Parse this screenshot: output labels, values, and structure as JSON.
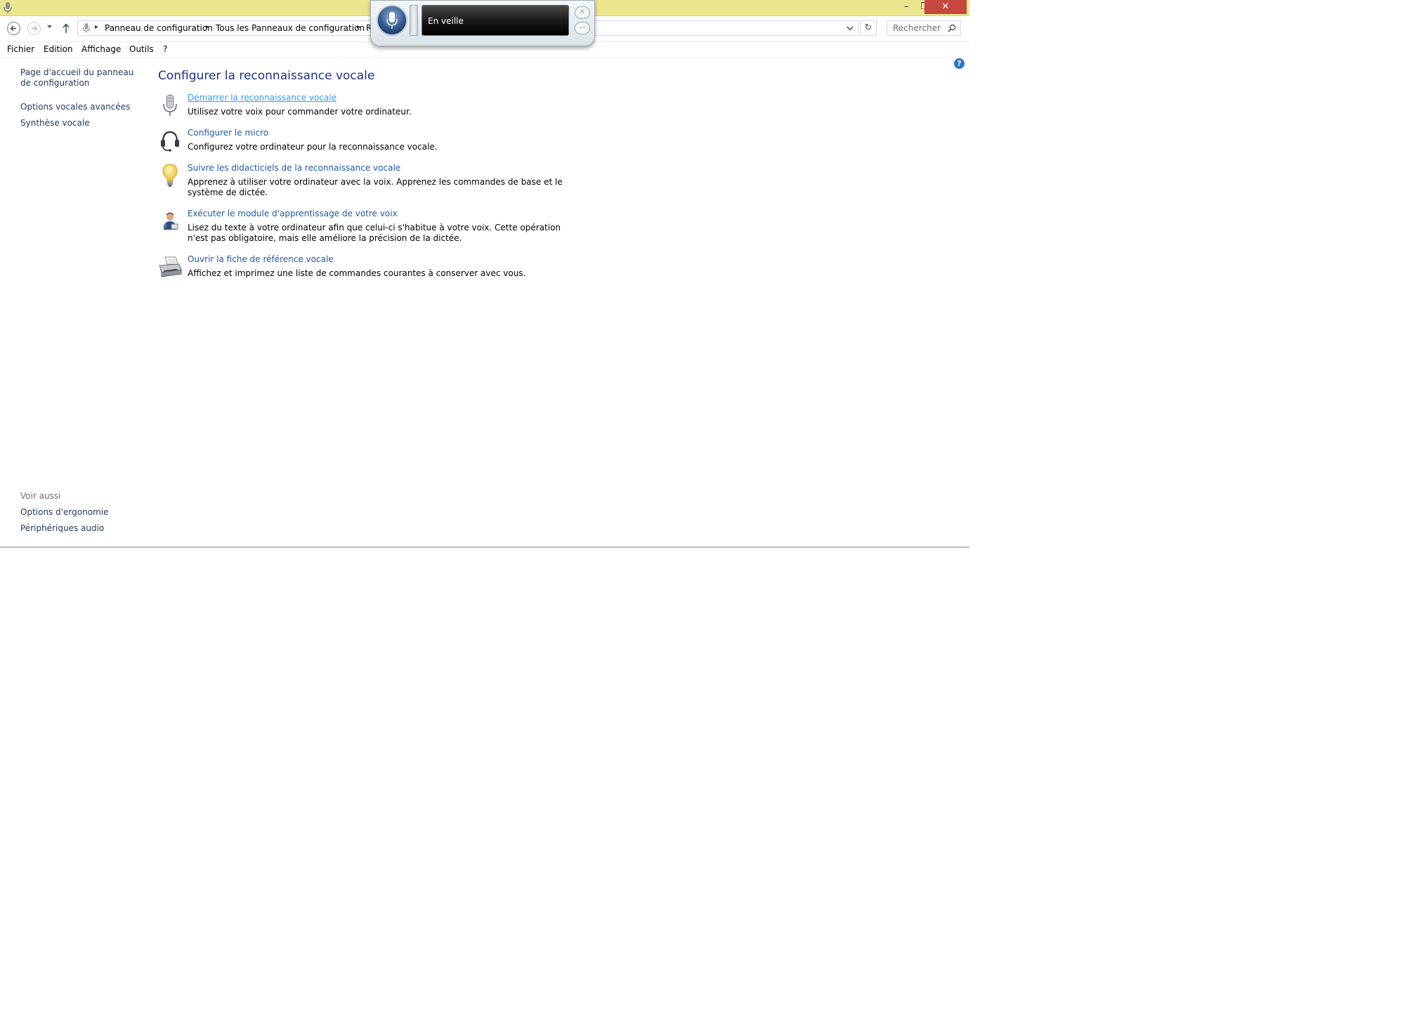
{
  "titlebar": {
    "minimize_glyph": "–",
    "maximize_glyph": "❐",
    "close_glyph": "✕"
  },
  "address": {
    "breadcrumbs": [
      "Panneau de configuration",
      "Tous les Panneaux de configuration",
      "R"
    ],
    "search_placeholder": "Rechercher",
    "refresh_glyph": "↻"
  },
  "menu": {
    "items": [
      "Fichier",
      "Edition",
      "Affichage",
      "Outils",
      "?"
    ]
  },
  "sidebar": {
    "home_link": "Page d'accueil du panneau de configuration",
    "links": [
      "Options vocales avancées",
      "Synthèse vocale"
    ],
    "see_also_heading": "Voir aussi",
    "see_also": [
      "Options d'ergonomie",
      "Périphériques audio"
    ]
  },
  "help": {
    "glyph": "?"
  },
  "main": {
    "title": "Configurer la reconnaissance vocale",
    "tasks": [
      {
        "icon": "microphone-icon",
        "link": "Démarrer la reconnaissance vocale",
        "description": "Utilisez votre voix pour commander votre ordinateur."
      },
      {
        "icon": "headset-icon",
        "link": "Configurer le micro",
        "description": "Configurez votre ordinateur pour la reconnaissance vocale."
      },
      {
        "icon": "lightbulb-icon",
        "link": "Suivre les didacticiels de la reconnaissance vocale",
        "description": "Apprenez à utiliser votre ordinateur avec la voix. Apprenez les commandes de base et le système de dictée."
      },
      {
        "icon": "user-training-icon",
        "link": "Exécuter le module d'apprentissage de votre voix",
        "description": "Lisez du texte à votre ordinateur afin que celui-ci s'habitue à votre voix. Cette opération n'est pas obligatoire, mais elle améliore la précision de la dictée."
      },
      {
        "icon": "printer-icon",
        "link": "Ouvrir la fiche de référence vocale",
        "description": "Affichez et imprimez une liste de commandes courantes à conserver avec vous."
      }
    ]
  },
  "speech_widget": {
    "status": "En veille",
    "close_glyph": "✕",
    "minimize_glyph": "—"
  },
  "colors": {
    "titlebar": "#ebe68d",
    "link": "#1c5aa6",
    "title": "#1e3287",
    "close_button": "#c7483e"
  }
}
